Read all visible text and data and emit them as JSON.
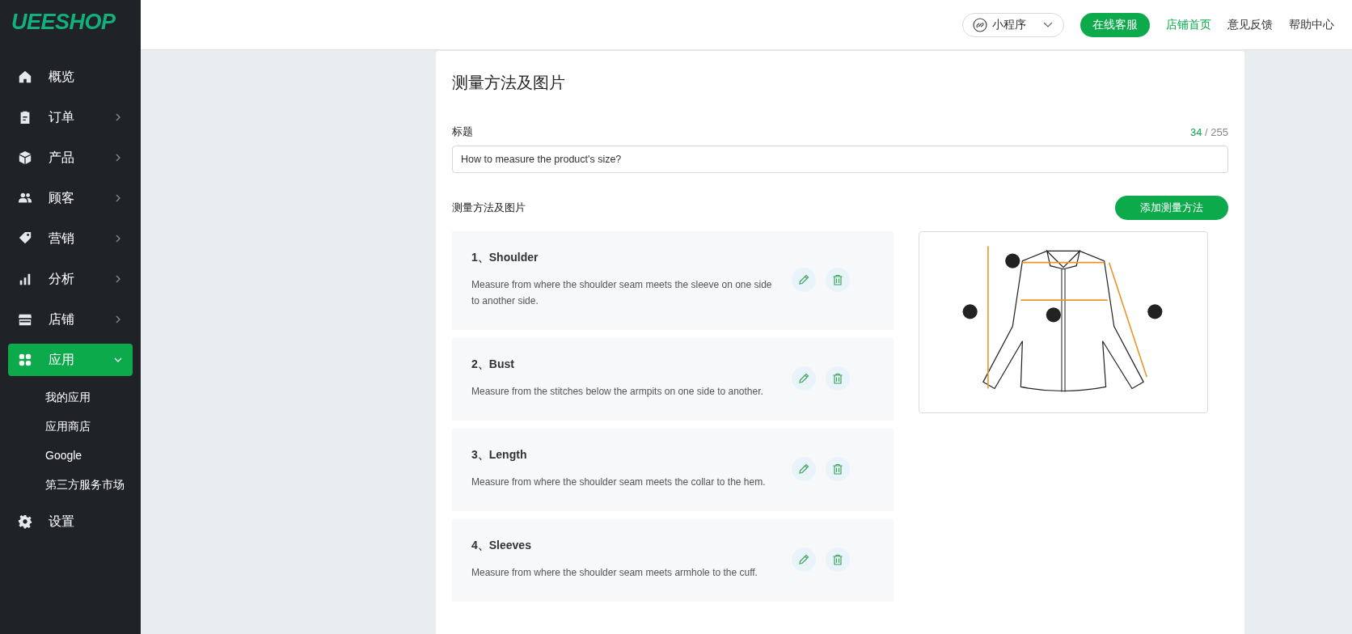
{
  "logo": "UEESHOP",
  "nav": [
    {
      "label": "概览",
      "selected": false
    },
    {
      "label": "订单",
      "selected": false,
      "expanded": false
    },
    {
      "label": "产品",
      "selected": false,
      "expanded": false
    },
    {
      "label": "顾客",
      "selected": false,
      "expanded": false
    },
    {
      "label": "营销",
      "selected": false,
      "expanded": false
    },
    {
      "label": "分析",
      "selected": false,
      "expanded": false
    },
    {
      "label": "店铺",
      "selected": false,
      "expanded": false
    },
    {
      "label": "应用",
      "selected": true,
      "expanded": true,
      "children": [
        {
          "label": "我的应用",
          "selected": false
        },
        {
          "label": "应用商店",
          "selected": false
        },
        {
          "label": "Google",
          "selected": false
        },
        {
          "label": "第三方服务市场",
          "selected": false
        }
      ]
    },
    {
      "label": "设置",
      "selected": false
    }
  ],
  "header": {
    "mini_program": "小程序",
    "service_button": "在线客服",
    "links": [
      {
        "label": "店铺首页",
        "selected": true
      },
      {
        "label": "意见反馈",
        "selected": false
      },
      {
        "label": "帮助中心",
        "selected": false
      }
    ]
  },
  "card": {
    "title": "测量方法及图片",
    "field_label": "标题",
    "count": "34",
    "limit": "/ 255",
    "title_value": "How to measure the product's size?",
    "section_label": "测量方法及图片",
    "add_button": "添加测量方法",
    "methods": [
      {
        "title": "1、Shoulder",
        "description": "Measure from where the shoulder seam meets the sleeve on one side to another side."
      },
      {
        "title": "2、Bust",
        "description": "Measure from the stitches below the armpits on one side to another."
      },
      {
        "title": "3、Length",
        "description": "Measure from where the shoulder seam meets the collar to the hem."
      },
      {
        "title": "4、Sleeves",
        "description": "Measure from where the shoulder seam meets armhole to the cuff."
      }
    ]
  }
}
